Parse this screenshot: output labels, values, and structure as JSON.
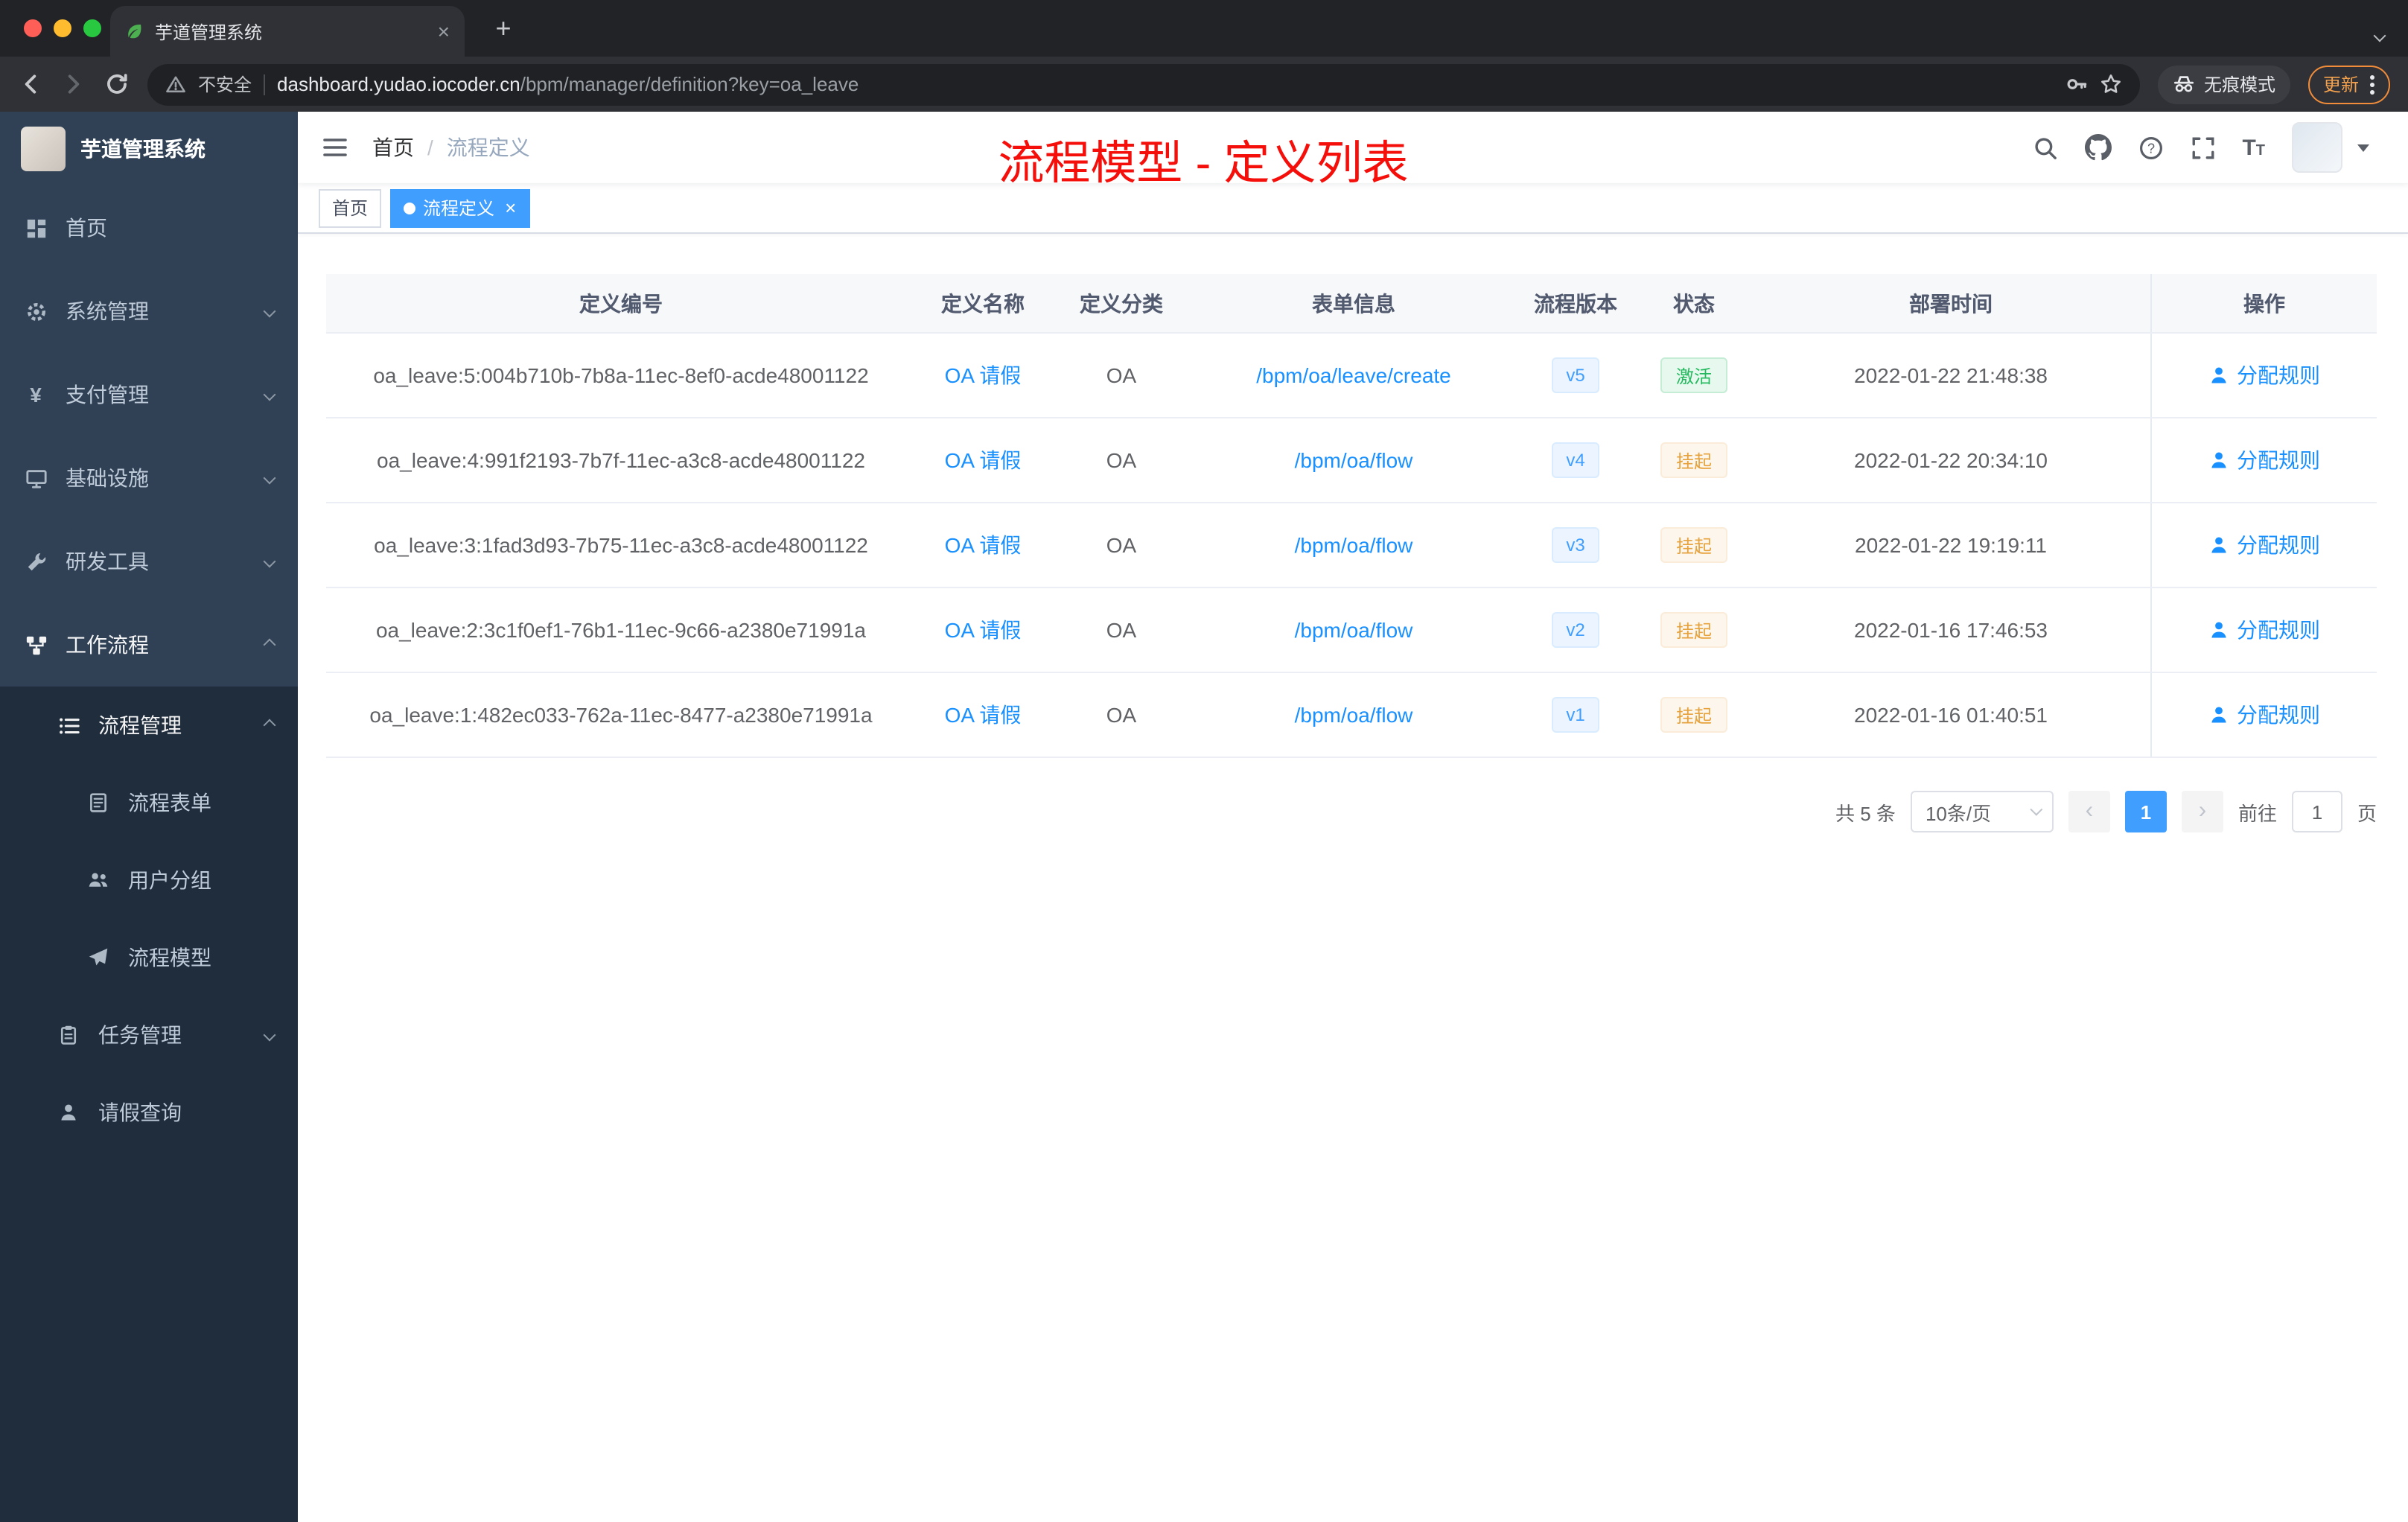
{
  "theme": {
    "accent": "#409eff",
    "link": "#1890ff",
    "success": "#23b85e",
    "warning": "#e6a23c",
    "annotation": "#f50f0b",
    "sidebar_bg": "#304156",
    "sidebar_sub_bg": "#1f2d3d"
  },
  "browser": {
    "tab_title": "芋道管理系统",
    "close_glyph": "×",
    "new_tab_glyph": "+",
    "security_label": "不安全",
    "url_host": "dashboard.yudao.iocoder.cn",
    "url_path": "/bpm/manager/definition?key=oa_leave",
    "incognito_label": "无痕模式",
    "update_label": "更新"
  },
  "sidebar": {
    "logo_title": "芋道管理系统",
    "items": [
      {
        "label": "首页"
      },
      {
        "label": "系统管理"
      },
      {
        "label": "支付管理"
      },
      {
        "label": "基础设施"
      },
      {
        "label": "研发工具"
      },
      {
        "label": "工作流程"
      },
      {
        "label": "流程管理"
      },
      {
        "label": "流程表单"
      },
      {
        "label": "用户分组"
      },
      {
        "label": "流程模型"
      },
      {
        "label": "任务管理"
      },
      {
        "label": "请假查询"
      }
    ]
  },
  "header": {
    "breadcrumb": [
      "首页",
      "流程定义"
    ],
    "annotation": "流程模型 - 定义列表"
  },
  "tags": {
    "items": [
      {
        "label": "首页",
        "active": false
      },
      {
        "label": "流程定义",
        "active": true
      }
    ],
    "close_glyph": "×"
  },
  "table": {
    "columns": [
      "定义编号",
      "定义名称",
      "定义分类",
      "表单信息",
      "流程版本",
      "状态",
      "部署时间",
      "操作"
    ],
    "rows": [
      {
        "id": "oa_leave:5:004b710b-7b8a-11ec-8ef0-acde48001122",
        "name": "OA 请假",
        "category": "OA",
        "form": "/bpm/oa/leave/create",
        "version": "v5",
        "status": "激活",
        "status_type": "success",
        "time": "2022-01-22 21:48:38",
        "action": "分配规则"
      },
      {
        "id": "oa_leave:4:991f2193-7b7f-11ec-a3c8-acde48001122",
        "name": "OA 请假",
        "category": "OA",
        "form": "/bpm/oa/flow",
        "version": "v4",
        "status": "挂起",
        "status_type": "warning",
        "time": "2022-01-22 20:34:10",
        "action": "分配规则"
      },
      {
        "id": "oa_leave:3:1fad3d93-7b75-11ec-a3c8-acde48001122",
        "name": "OA 请假",
        "category": "OA",
        "form": "/bpm/oa/flow",
        "version": "v3",
        "status": "挂起",
        "status_type": "warning",
        "time": "2022-01-22 19:19:11",
        "action": "分配规则"
      },
      {
        "id": "oa_leave:2:3c1f0ef1-76b1-11ec-9c66-a2380e71991a",
        "name": "OA 请假",
        "category": "OA",
        "form": "/bpm/oa/flow",
        "version": "v2",
        "status": "挂起",
        "status_type": "warning",
        "time": "2022-01-16 17:46:53",
        "action": "分配规则"
      },
      {
        "id": "oa_leave:1:482ec033-762a-11ec-8477-a2380e71991a",
        "name": "OA 请假",
        "category": "OA",
        "form": "/bpm/oa/flow",
        "version": "v1",
        "status": "挂起",
        "status_type": "warning",
        "time": "2022-01-16 01:40:51",
        "action": "分配规则"
      }
    ]
  },
  "pagination": {
    "total": "共 5 条",
    "page_size": "10条/页",
    "prev": "‹",
    "next": "›",
    "current": "1",
    "goto_label": "前往",
    "goto_value": "1",
    "unit": "页"
  }
}
